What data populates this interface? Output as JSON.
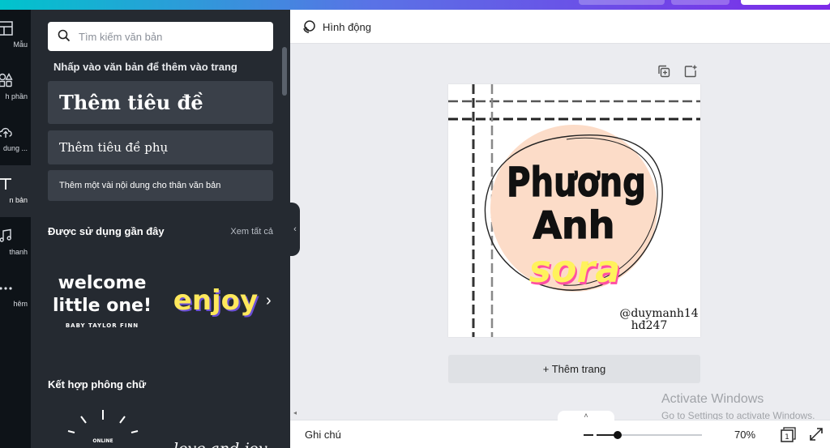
{
  "left_rail": {
    "items": [
      {
        "label": "Mẫu",
        "icon": "layout-icon",
        "active": false
      },
      {
        "label": "h phần",
        "icon": "elements-icon",
        "active": false
      },
      {
        "label": "dung ...",
        "icon": "upload-icon",
        "active": false
      },
      {
        "label": "n bản",
        "icon": "text-icon",
        "active": true
      },
      {
        "label": "thanh",
        "icon": "music-icon",
        "active": false
      },
      {
        "label": "hêm",
        "icon": "more-icon",
        "active": false
      }
    ]
  },
  "text_panel": {
    "search_placeholder": "Tìm kiếm văn bản",
    "hint": "Nhấp vào văn bản để thêm vào trang",
    "add_heading": "Thêm tiêu đề",
    "add_subheading": "Thêm tiêu đề phụ",
    "add_body": "Thêm một vài nội dung cho thân văn bản",
    "recent_title": "Được sử dụng gần đây",
    "see_all": "Xem tất cả",
    "recent_items": [
      {
        "line1": "welcome",
        "line2": "little one!",
        "line3": "BABY TAYLOR FINN"
      },
      {
        "text": "enjoy"
      }
    ],
    "combos_title": "Kết hợp phông chữ",
    "combo_items": [
      {
        "text": "ONLINE"
      },
      {
        "text": "love and joy"
      }
    ]
  },
  "toolbar": {
    "animate_label": "Hình động"
  },
  "design": {
    "name_line1": "Phương",
    "name_line2": "Anh",
    "name_line3": "sora",
    "handle": "@duymanh14",
    "handle2": "hđ247",
    "circle_color": "#fcdcc8",
    "accent_yellow": "#fff25c",
    "accent_pink": "#ff4fa3"
  },
  "add_page_label": "+ Thêm trang",
  "watermark": {
    "line1": "Activate Windows",
    "line2": "Go to Settings to activate Windows."
  },
  "bottom": {
    "notes_label": "Ghi chú",
    "zoom_value": "70%",
    "zoom_fraction": 0.2,
    "page_count": "1"
  }
}
